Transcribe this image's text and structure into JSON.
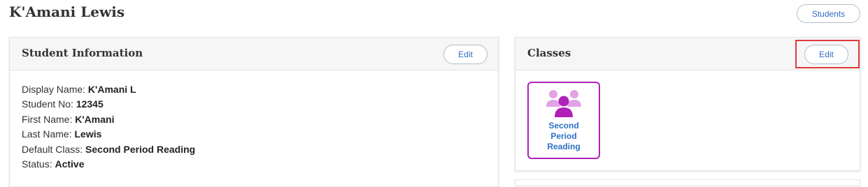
{
  "page": {
    "title": "K'Amani Lewis",
    "students_button": "Students"
  },
  "student_info": {
    "title": "Student Information",
    "edit_label": "Edit",
    "rows": [
      {
        "label": "Display Name: ",
        "value": "K'Amani L"
      },
      {
        "label": "Student No: ",
        "value": "12345"
      },
      {
        "label": "First Name: ",
        "value": "K'Amani"
      },
      {
        "label": "Last Name: ",
        "value": "Lewis"
      },
      {
        "label": "Default Class: ",
        "value": "Second Period Reading"
      },
      {
        "label": "Status: ",
        "value": "Active"
      }
    ]
  },
  "classes": {
    "title": "Classes",
    "edit_label": "Edit",
    "items": [
      {
        "name": "Second Period Reading",
        "icon": "group-icon"
      }
    ]
  },
  "colors": {
    "accent_link": "#2e6fc4",
    "class_tile_border": "#b020b8",
    "highlight": "#e03a3a"
  }
}
